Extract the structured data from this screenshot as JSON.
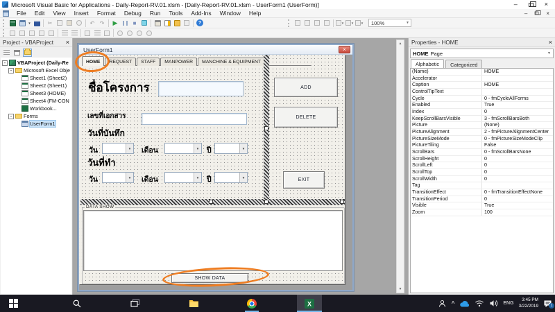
{
  "window": {
    "title": "Microsoft Visual Basic for Applications - Daily-Report-RV.01.xlsm - [Daily-Report-RV.01.xlsm - UserForm1 (UserForm)]"
  },
  "menu": {
    "items": [
      "File",
      "Edit",
      "View",
      "Insert",
      "Format",
      "Debug",
      "Run",
      "Tools",
      "Add-Ins",
      "Window",
      "Help"
    ]
  },
  "toolbar": {
    "zoom": "100%"
  },
  "project_panel": {
    "title": "Project - VBAProject",
    "tree": [
      {
        "label": "VBAProject (Daily-Re",
        "icon": "vbaproject",
        "indent": 0,
        "expander": "-",
        "bold": true
      },
      {
        "label": "Microsoft Excel Obje",
        "icon": "folder",
        "indent": 1,
        "expander": "-"
      },
      {
        "label": "Sheet1 (Sheet2)",
        "icon": "sheet",
        "indent": 2
      },
      {
        "label": "Sheet2 (Sheet1)",
        "icon": "sheet",
        "indent": 2
      },
      {
        "label": "Sheet3 (HOME)",
        "icon": "sheet",
        "indent": 2
      },
      {
        "label": "Sheet4 (FM-CON",
        "icon": "sheet",
        "indent": 2
      },
      {
        "label": "Workbook...",
        "icon": "workbook",
        "indent": 2
      },
      {
        "label": "Forms",
        "icon": "folder",
        "indent": 1,
        "expander": "-"
      },
      {
        "label": "UserForm1",
        "icon": "form",
        "indent": 2,
        "selected": true
      }
    ]
  },
  "designer": {
    "window_title": "UserForm1",
    "tabs": [
      {
        "label": "HOME",
        "active": true
      },
      {
        "label": "REQUEST"
      },
      {
        "label": "STAFF"
      },
      {
        "label": "MANPOWER"
      },
      {
        "label": "MANCHINE & EQUIPMENT"
      }
    ],
    "form": {
      "project_name_label": "ชื่อโครงการ",
      "doc_no_label": "เลขที่เอกสาร",
      "record_date_label": "วันที่บันทึก",
      "made_date_label": "วันที่ทำ",
      "day_label": "วัน",
      "month_label": "เดือน",
      "year_label": "ปี",
      "add_button": "ADD",
      "delete_button": "DELETE",
      "exit_button": "EXIT",
      "data_frame_label": "DATA SHOW",
      "show_data_button": "SHOW DATA"
    }
  },
  "properties_panel": {
    "title": "Properties - HOME",
    "object_name": "HOME",
    "object_type": "Page",
    "tab_alphabetic": "Alphabetic",
    "tab_categorized": "Categorized",
    "rows": [
      {
        "name": "(Name)",
        "value": "HOME"
      },
      {
        "name": "Accelerator",
        "value": ""
      },
      {
        "name": "Caption",
        "value": "HOME"
      },
      {
        "name": "ControlTipText",
        "value": ""
      },
      {
        "name": "Cycle",
        "value": "0 - fmCycleAllForms"
      },
      {
        "name": "Enabled",
        "value": "True"
      },
      {
        "name": "Index",
        "value": "0"
      },
      {
        "name": "KeepScrollBarsVisible",
        "value": "3 - fmScrollBarsBoth"
      },
      {
        "name": "Picture",
        "value": "(None)"
      },
      {
        "name": "PictureAlignment",
        "value": "2 - fmPictureAlignmentCenter"
      },
      {
        "name": "PictureSizeMode",
        "value": "0 - fmPictureSizeModeClip"
      },
      {
        "name": "PictureTiling",
        "value": "False"
      },
      {
        "name": "ScrollBars",
        "value": "0 - fmScrollBarsNone"
      },
      {
        "name": "ScrollHeight",
        "value": "0"
      },
      {
        "name": "ScrollLeft",
        "value": "0"
      },
      {
        "name": "ScrollTop",
        "value": "0"
      },
      {
        "name": "ScrollWidth",
        "value": "0"
      },
      {
        "name": "Tag",
        "value": ""
      },
      {
        "name": "TransitionEffect",
        "value": "0 - fmTransitionEffectNone"
      },
      {
        "name": "TransitionPeriod",
        "value": "0"
      },
      {
        "name": "Visible",
        "value": "True"
      },
      {
        "name": "Zoom",
        "value": "100"
      }
    ]
  },
  "taskbar": {
    "language": "ENG",
    "time": "3:45 PM",
    "date": "3/22/2019",
    "notification_count": "1"
  },
  "icons": {
    "close": "×",
    "minimize": "–",
    "dropdown": "▼",
    "scroll_up": "▲",
    "scroll_down": "▼",
    "run": "▶",
    "stop": "■",
    "cut": "✂",
    "undo": "↶",
    "redo": "↷",
    "help": "?",
    "tray_caret": "^"
  },
  "colors": {
    "annotation_orange": "#EE7D22",
    "selection_blue": "#CBE4FA",
    "run_green": "#2F9E44",
    "taskbar_bg": "#191922",
    "excel_green": "#1D6F42"
  }
}
